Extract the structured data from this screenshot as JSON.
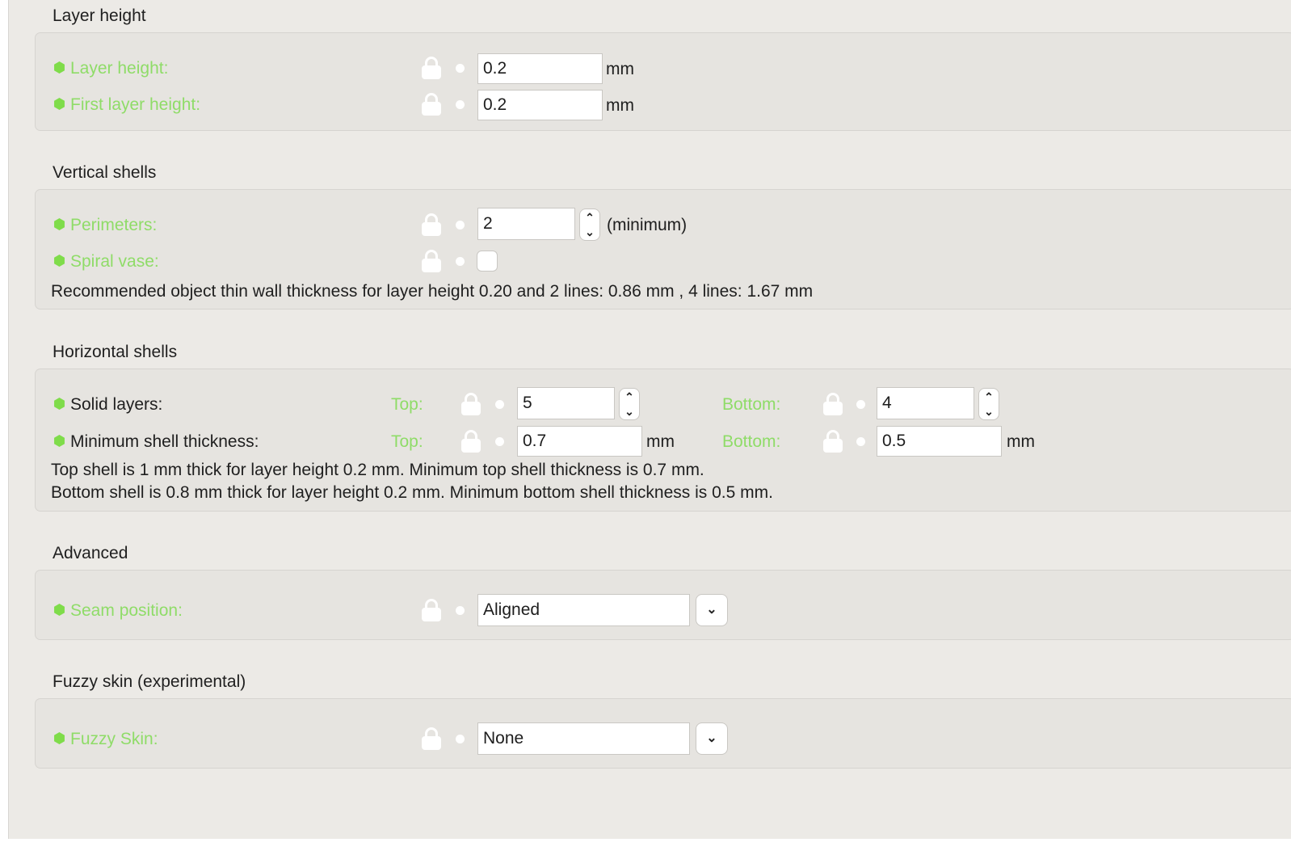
{
  "groups": {
    "layer_height": {
      "title": "Layer height",
      "rows": [
        {
          "label": "Layer height:",
          "value": "0.2",
          "unit": "mm"
        },
        {
          "label": "First layer height:",
          "value": "0.2",
          "unit": "mm"
        }
      ]
    },
    "vertical_shells": {
      "title": "Vertical shells",
      "perimeters": {
        "label": "Perimeters:",
        "value": "2",
        "unit": "(minimum)"
      },
      "spiral_vase": {
        "label": "Spiral vase:",
        "checked": false
      },
      "info": "Recommended object thin wall thickness for layer height 0.20 and 2 lines: 0.86 mm , 4 lines: 1.67 mm"
    },
    "horizontal_shells": {
      "title": "Horizontal shells",
      "solid_layers": {
        "label": "Solid layers:",
        "top_label": "Top:",
        "top_value": "5",
        "bottom_label": "Bottom:",
        "bottom_value": "4"
      },
      "min_shell": {
        "label": "Minimum shell thickness:",
        "top_label": "Top:",
        "top_value": "0.7",
        "top_unit": "mm",
        "bottom_label": "Bottom:",
        "bottom_value": "0.5",
        "bottom_unit": "mm"
      },
      "info_top": "Top shell is 1 mm thick for layer height 0.2 mm. Minimum top shell thickness is 0.7 mm.",
      "info_bottom": "Bottom shell is 0.8 mm thick for layer height 0.2 mm. Minimum bottom shell thickness is 0.5 mm."
    },
    "advanced": {
      "title": "Advanced",
      "seam_position": {
        "label": "Seam position:",
        "value": "Aligned"
      }
    },
    "fuzzy_skin": {
      "title": "Fuzzy skin (experimental)",
      "fuzzy": {
        "label": "Fuzzy Skin:",
        "value": "None"
      }
    }
  },
  "icons": {
    "lock": "lock-icon",
    "bullet": "dot-icon",
    "mode": "hexagon-icon",
    "spin": "chevron-up-down-icon",
    "dropdown": "chevron-down-icon"
  },
  "colors": {
    "accent_green": "#8fdc68",
    "mode_hex": "#7fdc4a"
  }
}
